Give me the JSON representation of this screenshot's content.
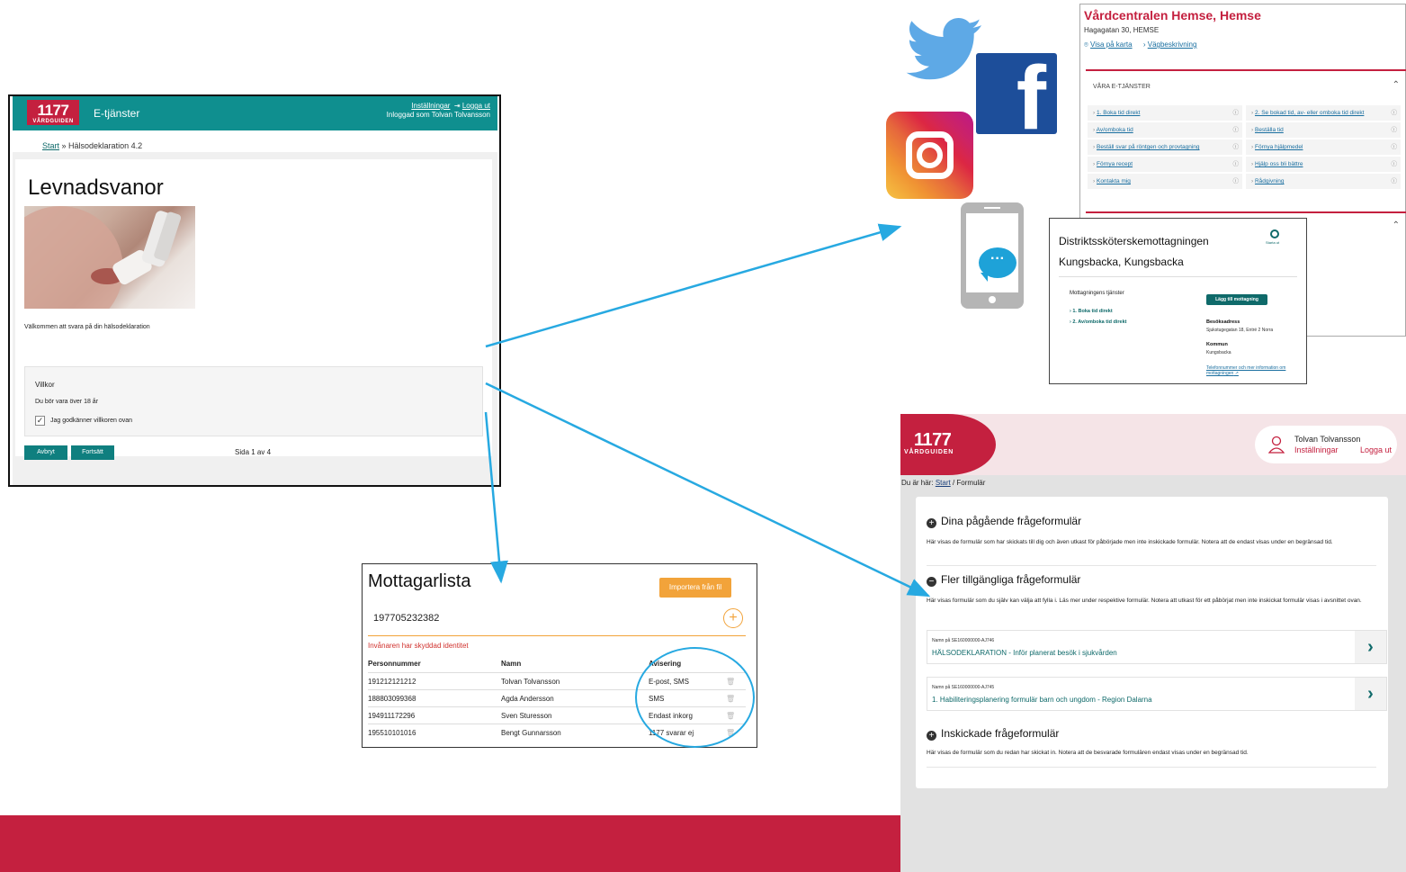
{
  "levnadsvanor": {
    "logo_big": "1177",
    "logo_small": "VÅRDGUIDEN",
    "service": "E-tjänster",
    "settings": "Inställningar",
    "logout": "Logga ut",
    "logged_in": "Inloggad som Tolvan Tolvansson",
    "crumb_start": "Start",
    "crumb_rest": "» Hälsodeklaration 4.2",
    "title": "Levnadsvanor",
    "welcome": "Välkommen att svara på din hälsodeklaration",
    "terms_title": "Villkor",
    "terms_text": "Du bör vara över 18 år",
    "accept_label": "Jag godkänner villkoren ovan",
    "cancel": "Avbryt",
    "next": "Fortsätt",
    "page": "Sida 1 av 4"
  },
  "mottagarlista": {
    "title": "Mottagarlista",
    "import": "Importera från fil",
    "input_value": "197705232382",
    "warning": "Invånaren har skyddad identitet",
    "headers": [
      "Personnummer",
      "Namn",
      "Avisering"
    ],
    "rows": [
      [
        "191212121212",
        "Tolvan Tolvansson",
        "E-post, SMS"
      ],
      [
        "188803099368",
        "Agda Andersson",
        "SMS"
      ],
      [
        "194911172296",
        "Sven Sturesson",
        "Endast inkorg"
      ],
      [
        "195510101016",
        "Bengt Gunnarsson",
        "1177 svarar ej"
      ]
    ]
  },
  "hemse": {
    "name": "Vårdcentralen Hemse, Hemse",
    "address": "Hagagatan 30, HEMSE",
    "map": "Visa på karta",
    "directions": "Vägbeskrivning",
    "section": "VÅRA E-TJÄNSTER",
    "services_left": [
      "1. Boka tid direkt",
      "Av/omboka tid",
      "Beställ svar på röntgen och provtagning",
      "Förnya recept",
      "Kontakta mig"
    ],
    "services_right": [
      "2. Se bokad tid, av- eller omboka tid direkt",
      "Beställa tid",
      "Förnya hjälpmedel",
      "Hjälp oss bli bättre",
      "Rådgivning"
    ]
  },
  "distrikt": {
    "title1": "Distriktssköterskemottagningen",
    "title2": "Kungsbacka, Kungsbacka",
    "start": "Starta ut",
    "services": "Mottagningens tjänster",
    "link1": "1. Boka tid direkt",
    "link2": "2. Av/omboka tid direkt",
    "add": "Lägg till mottagning",
    "visit_label": "Besöksadress",
    "visit_value": "Sjukstugegatan 18, Entré 2 Norra",
    "muni_label": "Kommun",
    "muni_value": "Kungsbacka",
    "phone_link": "Telefonnummer och mer information om mottagningen"
  },
  "formular": {
    "logo_big": "1177",
    "logo_small": "VÅRDGUIDEN",
    "user_name": "Tolvan Tolvansson",
    "settings": "Inställningar",
    "logout": "Logga ut",
    "crumb_prefix": "Du är här:",
    "crumb_start": "Start",
    "crumb_rest": "/ Formulär",
    "s1_title": "Dina pågående frågeformulär",
    "s1_desc": "Här visas de formulär som har skickats till dig och även utkast för påbörjade men inte inskickade formulär. Notera att de endast visas under en begränsad tid.",
    "s2_title": "Fler tillgängliga frågeformulär",
    "s2_desc": "Här visas formulär som du själv kan välja att fylla i. Läs mer under respektive formulär. Notera att utkast för ett påbörjat men inte inskickat formulär visas i avsnittet ovan.",
    "form1_key": "Namn på SE160000000-AJ746",
    "form1_title": "HÄLSODEKLARATION - Inför planerat besök i sjukvården",
    "form2_key": "Namn på SE160000000-AJ745",
    "form2_title": "1. Habiliteringsplanering formulär barn och ungdom - Region Dalarna",
    "s3_title": "Inskickade frågeformulär",
    "s3_desc": "Här visas de formulär som du redan har skickat in. Notera att de besvarade formulären endast visas under en begränsad tid."
  },
  "colors": {
    "brand_red": "#c4203f",
    "teal": "#0f8f8f",
    "arrow": "#27a9e1",
    "orange": "#f2a33a"
  }
}
